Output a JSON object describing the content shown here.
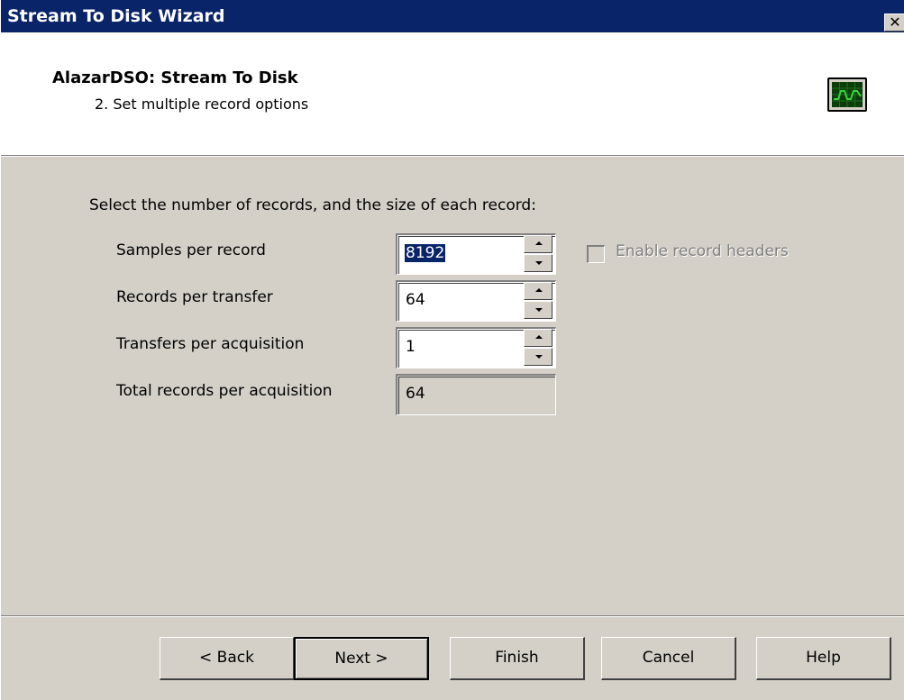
{
  "window": {
    "title": "Stream To Disk Wizard",
    "close_label": "✕"
  },
  "header": {
    "title": "AlazarDSO: Stream To Disk",
    "step": "2. Set multiple record options",
    "icon": "oscilloscope-icon"
  },
  "form": {
    "instruction": "Select the number of records, and the size of each record:",
    "rows": [
      {
        "label": "Samples per record",
        "value": "8192"
      },
      {
        "label": "Records per transfer",
        "value": "64"
      },
      {
        "label": "Transfers per acquisition",
        "value": "1"
      },
      {
        "label": "Total records per acquisition",
        "value": "64"
      }
    ],
    "enable_headers": {
      "label": "Enable record headers",
      "checked": false,
      "enabled": false
    }
  },
  "buttons": {
    "back": "< Back",
    "next": "Next >",
    "finish": "Finish",
    "cancel": "Cancel",
    "help": "Help"
  },
  "colors": {
    "titlebar": "#0a246a",
    "face": "#d4d0c8",
    "scope_screen": "#0b3d0b",
    "scope_trace": "#39d139"
  }
}
